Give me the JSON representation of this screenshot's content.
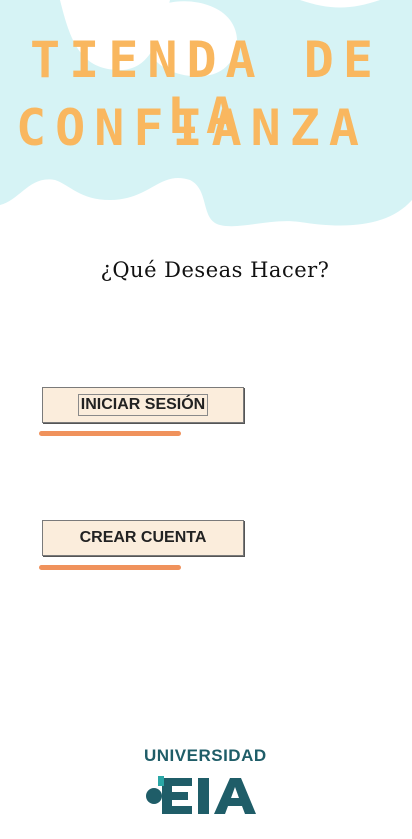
{
  "header": {
    "title_line1": "TIENDA DE LA",
    "title_line2": "CONFIANZA",
    "title_color": "#f9b75f",
    "background_shape_color": "#d6f3f5"
  },
  "main": {
    "prompt": "¿Qué Deseas Hacer?",
    "login_button_label": "INICIAR SESIÓN",
    "signup_button_label": "CREAR CUENTA",
    "button_bg": "#fbeddc",
    "underline_color": "#f0925c"
  },
  "footer": {
    "logo_text": "UNIVERSIDAD",
    "logo_letters": "EIA",
    "logo_color": "#1f5d68",
    "logo_accent_color": "#2aa7a6"
  }
}
